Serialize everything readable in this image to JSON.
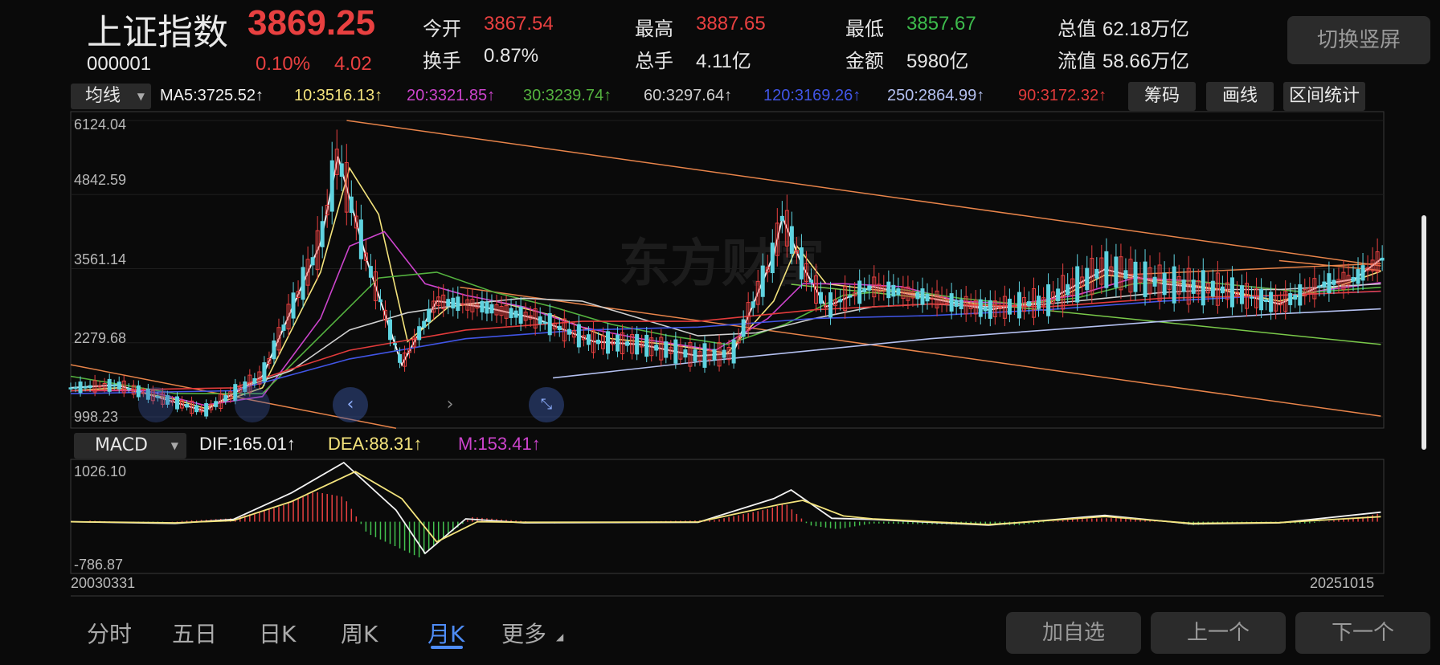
{
  "header": {
    "title": "上证指数",
    "price": "3869.25",
    "code": "000001",
    "change_pct": "0.10%",
    "change_val": "4.02",
    "stats": [
      {
        "label": "今开",
        "value": "3867.54",
        "color": "red"
      },
      {
        "label": "换手",
        "value": "0.87%",
        "color": "lbl"
      },
      {
        "label": "最高",
        "value": "3887.65",
        "color": "red"
      },
      {
        "label": "总手",
        "value": "4.11亿",
        "color": "lbl"
      },
      {
        "label": "最低",
        "value": "3857.67",
        "color": "green"
      },
      {
        "label": "金额",
        "value": "5980亿",
        "color": "lbl"
      },
      {
        "label": "总值",
        "value": "62.18万亿",
        "color": "lbl"
      },
      {
        "label": "流值",
        "value": "58.66万亿",
        "color": "lbl"
      }
    ],
    "rotate_button": "切换竖屏"
  },
  "ma_bar": {
    "dropdown": "均线",
    "items": [
      {
        "text": "MA5:3725.52↑",
        "color": "#f2f2f2"
      },
      {
        "text": "10:3516.13↑",
        "color": "#f3e37c"
      },
      {
        "text": "20:3321.85↑",
        "color": "#cc44cc"
      },
      {
        "text": "30:3239.74↑",
        "color": "#54b23f"
      },
      {
        "text": "60:3297.64↑",
        "color": "#d0d0d0"
      },
      {
        "text": "120:3169.26↑",
        "color": "#4155e6"
      },
      {
        "text": "250:2864.99↑",
        "color": "#b4c0f0"
      },
      {
        "text": "90:3172.32↑",
        "color": "#e23b3b"
      }
    ],
    "buttons": [
      "筹码",
      "画线",
      "区间统计"
    ]
  },
  "main_chart": {
    "y_labels": [
      "6124.04",
      "4842.59",
      "3561.14",
      "2279.68",
      "998.23"
    ],
    "watermark": "东方财富"
  },
  "macd_bar": {
    "dropdown": "MACD",
    "dif": "DIF:165.01↑",
    "dea": "DEA:88.31↑",
    "m": "M:153.41↑",
    "y_top": "1026.10",
    "y_bottom": "-786.87"
  },
  "x_axis": {
    "start": "20030331",
    "end": "20251015"
  },
  "tabs": [
    "分时",
    "五日",
    "日K",
    "周K",
    "月K",
    "更多"
  ],
  "active_tab": "月K",
  "bottom_buttons": [
    "加自选",
    "上一个",
    "下一个"
  ],
  "chart_data": {
    "type": "line",
    "title": "上证指数",
    "x_range": [
      "20030331",
      "20251015"
    ],
    "ylim": [
      998.23,
      6124.04
    ],
    "y_ticks": [
      998.23,
      2279.68,
      3561.14,
      4842.59,
      6124.04
    ],
    "series": [
      {
        "name": "MA5",
        "x": [
          2003.2,
          2004.0,
          2005.0,
          2005.5,
          2006.5,
          2007.5,
          2007.8,
          2008.3,
          2008.9,
          2009.5,
          2010.3,
          2011.2,
          2012.2,
          2013.0,
          2014.0,
          2014.6,
          2015.3,
          2015.45,
          2015.8,
          2016.2,
          2017.0,
          2018.0,
          2019.0,
          2020.0,
          2021.0,
          2022.0,
          2023.0,
          2024.0,
          2024.8,
          2025.3,
          2025.75
        ],
        "values": [
          1500,
          1550,
          1250,
          1100,
          1700,
          4000,
          5500,
          3700,
          1900,
          3000,
          2900,
          2700,
          2300,
          2250,
          2050,
          2100,
          3800,
          4450,
          3600,
          2900,
          3250,
          3050,
          2850,
          3000,
          3550,
          3300,
          3200,
          2950,
          3300,
          3380,
          3725
        ]
      },
      {
        "name": "10",
        "x": [
          2003.2,
          2004.0,
          2005.0,
          2005.5,
          2006.5,
          2007.5,
          2008.0,
          2008.5,
          2009.0,
          2009.7,
          2010.5,
          2011.5,
          2012.5,
          2013.5,
          2014.5,
          2015.3,
          2015.7,
          2016.2,
          2017.0,
          2018.0,
          2019.0,
          2020.0,
          2021.0,
          2022.0,
          2023.0,
          2024.0,
          2025.0,
          2025.75
        ],
        "values": [
          1450,
          1500,
          1300,
          1150,
          1500,
          3500,
          5300,
          4500,
          2300,
          2900,
          3000,
          2750,
          2350,
          2250,
          2100,
          3000,
          3950,
          3300,
          3200,
          3100,
          2900,
          2950,
          3450,
          3350,
          3200,
          3000,
          3250,
          3516
        ]
      },
      {
        "name": "20",
        "x": [
          2003.2,
          2004.5,
          2005.5,
          2006.5,
          2007.5,
          2008.0,
          2008.6,
          2009.3,
          2010.0,
          2011.0,
          2012.0,
          2013.0,
          2014.3,
          2015.2,
          2015.8,
          2016.5,
          2017.5,
          2018.5,
          2019.5,
          2020.5,
          2021.5,
          2022.5,
          2023.5,
          2024.5,
          2025.75
        ],
        "values": [
          1450,
          1450,
          1200,
          1350,
          2700,
          3950,
          4200,
          3300,
          3100,
          2900,
          2550,
          2350,
          2150,
          2700,
          3300,
          3300,
          3250,
          3000,
          2950,
          3100,
          3400,
          3350,
          3250,
          3150,
          3321
        ]
      },
      {
        "name": "30",
        "x": [
          2003.2,
          2005.0,
          2006.5,
          2007.5,
          2008.5,
          2009.5,
          2010.5,
          2011.5,
          2012.5,
          2013.5,
          2014.5,
          2015.5,
          2016.5,
          2017.5,
          2018.5,
          2019.5,
          2020.5,
          2021.5,
          2022.5,
          2023.5,
          2024.5,
          2025.75
        ],
        "values": [
          1700,
          1400,
          1400,
          2400,
          3400,
          3500,
          3150,
          2900,
          2600,
          2400,
          2250,
          2600,
          3100,
          3200,
          3050,
          2950,
          3050,
          3300,
          3350,
          3250,
          3150,
          3239
        ]
      },
      {
        "name": "60",
        "x": [
          2006.0,
          2007.0,
          2008.0,
          2009.0,
          2010.0,
          2011.0,
          2012.0,
          2013.0,
          2014.0,
          2015.0,
          2016.0,
          2017.0,
          2018.0,
          2019.0,
          2020.0,
          2021.0,
          2022.0,
          2023.0,
          2024.0,
          2025.75
        ],
        "values": [
          1450,
          1800,
          2500,
          2800,
          2950,
          3050,
          3000,
          2700,
          2400,
          2450,
          2700,
          2900,
          2950,
          2900,
          2950,
          3050,
          3150,
          3200,
          3200,
          3297
        ]
      },
      {
        "name": "120",
        "x": [
          2003.2,
          2006.0,
          2008.0,
          2010.0,
          2012.0,
          2014.0,
          2016.0,
          2018.0,
          2020.0,
          2022.0,
          2024.0,
          2025.75
        ],
        "values": [
          1400,
          1450,
          2000,
          2350,
          2500,
          2550,
          2700,
          2750,
          2850,
          3000,
          3100,
          3169
        ]
      },
      {
        "name": "250",
        "x": [
          2011.5,
          2014.0,
          2016.0,
          2018.0,
          2020.0,
          2022.0,
          2024.0,
          2025.75
        ],
        "values": [
          1670,
          1950,
          2150,
          2350,
          2500,
          2650,
          2780,
          2865
        ]
      },
      {
        "name": "90",
        "x": [
          2003.2,
          2006.0,
          2008.0,
          2010.0,
          2012.0,
          2014.0,
          2016.0,
          2018.0,
          2020.0,
          2022.0,
          2024.0,
          2025.75
        ],
        "values": [
          1450,
          1500,
          2150,
          2500,
          2650,
          2650,
          2850,
          2950,
          2900,
          3050,
          3100,
          3172
        ]
      }
    ],
    "macd": {
      "ylim": [
        -786.87,
        1026.1
      ],
      "dif": [
        [
          2003.2,
          0
        ],
        [
          2005.0,
          -30
        ],
        [
          2006.0,
          40
        ],
        [
          2007.0,
          500
        ],
        [
          2007.9,
          1026
        ],
        [
          2008.8,
          200
        ],
        [
          2009.3,
          -550
        ],
        [
          2010.0,
          50
        ],
        [
          2011.0,
          -20
        ],
        [
          2014.0,
          -10
        ],
        [
          2015.3,
          400
        ],
        [
          2015.6,
          550
        ],
        [
          2016.3,
          60
        ],
        [
          2017.0,
          40
        ],
        [
          2019.0,
          -60
        ],
        [
          2021.0,
          110
        ],
        [
          2022.5,
          -40
        ],
        [
          2024.0,
          -20
        ],
        [
          2025.75,
          165
        ]
      ],
      "dea": [
        [
          2003.2,
          0
        ],
        [
          2005.0,
          -20
        ],
        [
          2006.0,
          20
        ],
        [
          2007.0,
          350
        ],
        [
          2008.1,
          870
        ],
        [
          2008.9,
          400
        ],
        [
          2009.5,
          -350
        ],
        [
          2010.2,
          0
        ],
        [
          2011.0,
          -10
        ],
        [
          2014.0,
          -5
        ],
        [
          2015.4,
          300
        ],
        [
          2015.8,
          370
        ],
        [
          2016.5,
          100
        ],
        [
          2017.0,
          50
        ],
        [
          2019.0,
          -50
        ],
        [
          2021.0,
          90
        ],
        [
          2022.5,
          -30
        ],
        [
          2024.0,
          -15
        ],
        [
          2025.75,
          88
        ]
      ],
      "m": [
        [
          2003.5,
          20
        ],
        [
          2004.5,
          -20
        ],
        [
          2006.0,
          60
        ],
        [
          2006.8,
          260
        ],
        [
          2007.4,
          520
        ],
        [
          2007.9,
          430
        ],
        [
          2008.3,
          -200
        ],
        [
          2008.9,
          -480
        ],
        [
          2009.2,
          -620
        ],
        [
          2009.6,
          -300
        ],
        [
          2010.1,
          80
        ],
        [
          2011.5,
          -30
        ],
        [
          2014.3,
          30
        ],
        [
          2015.2,
          220
        ],
        [
          2015.5,
          320
        ],
        [
          2015.9,
          -60
        ],
        [
          2016.4,
          -130
        ],
        [
          2017.0,
          -30
        ],
        [
          2018.5,
          -50
        ],
        [
          2019.5,
          -60
        ],
        [
          2020.5,
          50
        ],
        [
          2021.5,
          70
        ],
        [
          2022.5,
          -60
        ],
        [
          2023.5,
          -20
        ],
        [
          2024.5,
          -30
        ],
        [
          2025.5,
          90
        ],
        [
          2025.75,
          153
        ]
      ]
    }
  }
}
